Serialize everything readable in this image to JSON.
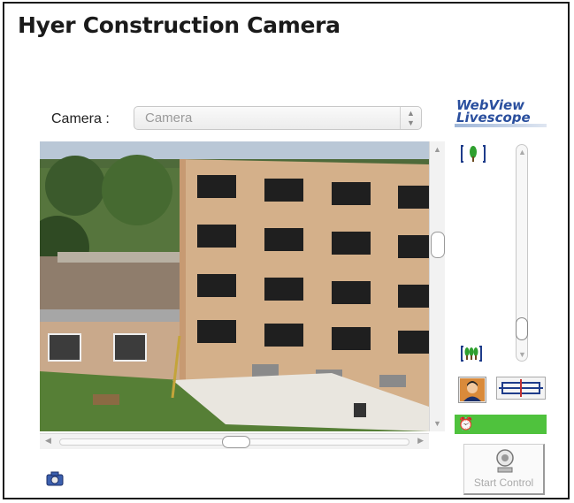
{
  "title": "Hyer Construction Camera",
  "brand": {
    "line1": "WebView",
    "line2": "Livescope"
  },
  "camera_selector": {
    "label": "Camera :",
    "value": "Camera"
  },
  "controls": {
    "start_label": "Start Control"
  },
  "icons": {
    "tele": "zoom-tele-icon",
    "wide": "zoom-wide-icon",
    "person": "person-icon",
    "ptz": "pan-tilt-icon",
    "alarm": "alarm-clock-icon",
    "snapshot": "camera-icon",
    "start": "webcam-icon"
  },
  "colors": {
    "status_bar": "#4fc23d",
    "brand": "#2a4f9e"
  }
}
